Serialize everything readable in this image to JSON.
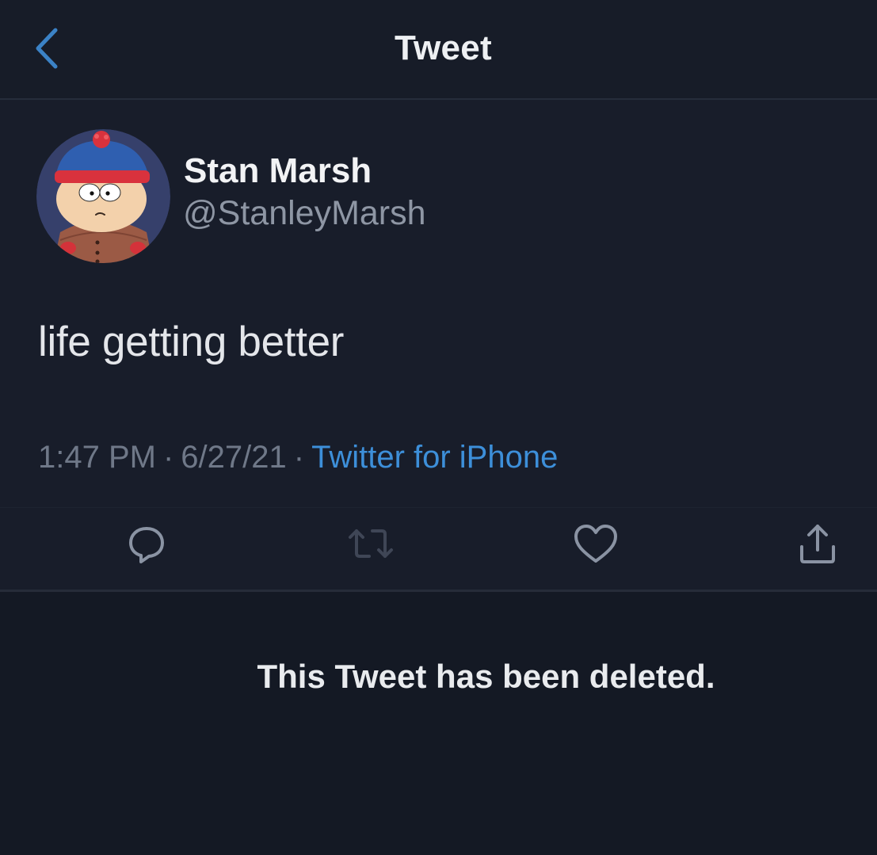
{
  "header": {
    "title": "Tweet",
    "back_icon": "chevron-left-icon"
  },
  "author": {
    "display_name": "Stan Marsh",
    "handle": "@StanleyMarsh",
    "avatar": "stan-marsh-avatar"
  },
  "tweet": {
    "text": "life getting better",
    "time": "1:47 PM",
    "date": "6/27/21",
    "separator": "·",
    "source": "Twitter for iPhone"
  },
  "actions": [
    {
      "name": "reply",
      "icon": "reply-bubble-icon"
    },
    {
      "name": "retweet",
      "icon": "retweet-icon"
    },
    {
      "name": "like",
      "icon": "heart-icon"
    },
    {
      "name": "share",
      "icon": "share-icon"
    }
  ],
  "notice": {
    "text": "This Tweet has been deleted."
  },
  "colors": {
    "background": "#181d2a",
    "accent": "#3d8fd9",
    "text_primary": "#f2f3f5",
    "text_secondary": "#8e96a4",
    "icon": "#8a93a3"
  }
}
